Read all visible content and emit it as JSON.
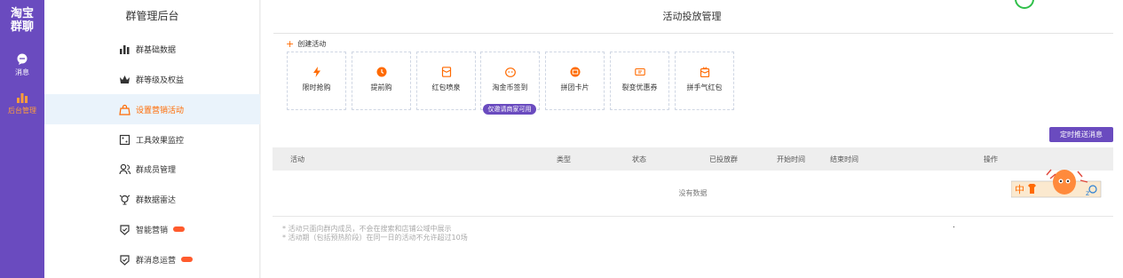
{
  "rail": {
    "logo_line1": "淘宝",
    "logo_line2": "群聊",
    "items": [
      {
        "label": "消息",
        "icon": "chat-bubble-icon"
      },
      {
        "label": "后台管理",
        "icon": "bar-chart-icon"
      }
    ]
  },
  "sidebar": {
    "title": "群管理后台",
    "items": [
      {
        "label": "群基础数据",
        "icon": "bar-chart-icon"
      },
      {
        "label": "群等级及权益",
        "icon": "crown-icon"
      },
      {
        "label": "设置营销活动",
        "icon": "bag-icon",
        "active": true
      },
      {
        "label": "工具效果监控",
        "icon": "monitor-icon"
      },
      {
        "label": "群成员管理",
        "icon": "members-icon"
      },
      {
        "label": "群数据雷达",
        "icon": "radar-icon"
      },
      {
        "label": "智能营销",
        "icon": "shield-check-icon",
        "badge": true
      },
      {
        "label": "群消息运营",
        "icon": "shield-check-icon",
        "badge": true
      }
    ]
  },
  "main": {
    "title": "活动投放管理",
    "create_label": "创建活动",
    "tools": [
      {
        "label": "限时抢购",
        "icon": "lightning-icon"
      },
      {
        "label": "提前购",
        "icon": "clock-icon"
      },
      {
        "label": "红包喷泉",
        "icon": "red-envelope-icon"
      },
      {
        "label": "淘金币签到",
        "icon": "coin-icon"
      },
      {
        "label": "拼团卡片",
        "icon": "group-card-icon"
      },
      {
        "label": "裂变优惠券",
        "icon": "coupon-icon"
      },
      {
        "label": "拼手气红包",
        "icon": "lucky-envelope-icon"
      }
    ],
    "tool_pill": "仅邀请商家可用",
    "schedule_button": "定时推送消息",
    "table": {
      "headers": [
        "活动",
        "类型",
        "状态",
        "已投放群",
        "开始时间",
        "结束时间",
        "操作"
      ],
      "empty": "没有数据"
    },
    "notes": [
      "* 活动只面向群内成员，不会在搜索和店铺公域中展示",
      "* 活动期（包括预热阶段）在同一日的活动不允许超过10场"
    ],
    "mascot_text": "中"
  },
  "colors": {
    "brand_purple": "#6a4bbf",
    "accent_orange": "#ff6a00",
    "active_bg": "#eaf3fb"
  }
}
